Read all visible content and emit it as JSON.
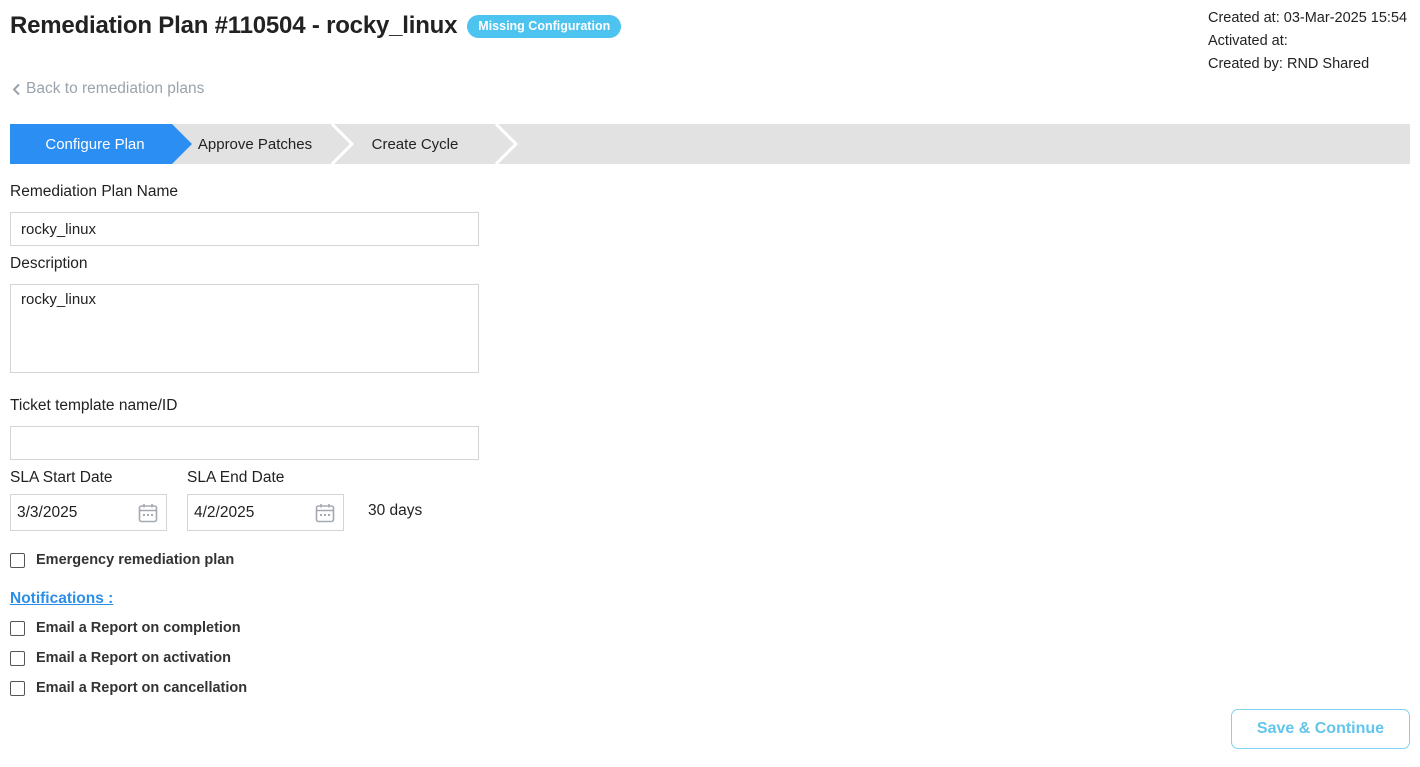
{
  "header": {
    "title": "Remediation Plan #110504 - rocky_linux",
    "status_badge": "Missing Configuration",
    "meta": {
      "created_at": "Created at: 03-Mar-2025 15:54",
      "activated_at": "Activated at:",
      "created_by": "Created by: RND Shared"
    },
    "back_link": "Back to remediation plans"
  },
  "stepper": {
    "steps": [
      {
        "label": "Configure Plan",
        "active": true
      },
      {
        "label": "Approve Patches",
        "active": false
      },
      {
        "label": "Create Cycle",
        "active": false
      }
    ]
  },
  "form": {
    "name_label": "Remediation Plan Name",
    "name_value": "rocky_linux",
    "description_label": "Description",
    "description_value": "rocky_linux",
    "ticket_label": "Ticket template name/ID",
    "ticket_value": "",
    "sla_start_label": "SLA Start Date",
    "sla_start_value": "3/3/2025",
    "sla_end_label": "SLA End Date",
    "sla_end_value": "4/2/2025",
    "sla_duration": "30 days",
    "emergency_label": "Emergency remediation plan",
    "emergency_checked": false
  },
  "notifications": {
    "heading": "Notifications :",
    "items": [
      {
        "label": "Email a Report on completion",
        "checked": false
      },
      {
        "label": "Email a Report on activation",
        "checked": false
      },
      {
        "label": "Email a Report on cancellation",
        "checked": false
      }
    ]
  },
  "actions": {
    "save_label": "Save & Continue"
  },
  "colors": {
    "accent": "#2b8ee8",
    "step_active": "#2b8ef2",
    "badge": "#4dc3f0",
    "save_border": "#7dd3f0"
  },
  "icons": {
    "back": "chevron-left-icon",
    "date": "calendar-icon"
  }
}
